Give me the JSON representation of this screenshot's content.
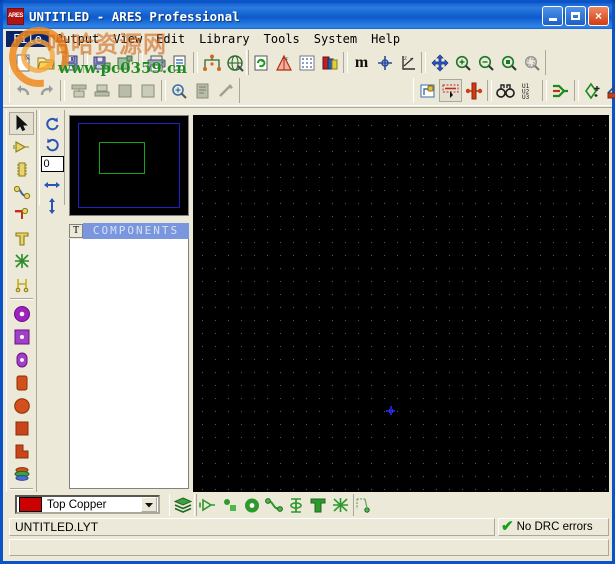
{
  "window": {
    "title": "UNTITLED - ARES Professional",
    "app_icon": "ares-icon",
    "icon_label": "ARES",
    "buttons": {
      "minimize": "minimize-button",
      "maximize": "maximize-button",
      "close": "×"
    }
  },
  "menu": [
    {
      "label": "File",
      "accel": "F",
      "selected": true
    },
    {
      "label": "Output",
      "accel": "O",
      "selected": false
    },
    {
      "label": "View",
      "accel": "V",
      "selected": false
    },
    {
      "label": "Edit",
      "accel": "E",
      "selected": false
    },
    {
      "label": "Library",
      "accel": "L",
      "selected": false
    },
    {
      "label": "Tools",
      "accel": "T",
      "selected": false
    },
    {
      "label": "System",
      "accel": "S",
      "selected": false
    },
    {
      "label": "Help",
      "accel": "H",
      "selected": false
    }
  ],
  "watermark": {
    "chinese": "哈哈资源网",
    "url": "www.pc0359.cn"
  },
  "toolbar_file": [
    {
      "icon": "new-file-icon",
      "title": "New Layout"
    },
    {
      "icon": "open-folder-icon",
      "title": "Open Layout"
    },
    {
      "icon": "save-disk-icon",
      "title": "Save Layout"
    },
    {
      "icon": "import-region-icon",
      "title": "Import Region"
    },
    {
      "icon": "export-region-icon",
      "title": "Export Region"
    },
    {
      "icon": "print-icon",
      "title": "Print Layout"
    },
    {
      "icon": "print-region-icon",
      "title": "Print Region"
    },
    {
      "icon": "netlist-icon",
      "title": "Netlist"
    },
    {
      "icon": "3d-view-icon",
      "title": "3D Visualisation"
    }
  ],
  "toolbar_view": [
    {
      "icon": "refresh-icon",
      "title": "Redraw Display"
    },
    {
      "icon": "layers-ar-icon",
      "title": "Auto Router"
    },
    {
      "icon": "grid-dots-icon",
      "title": "Toggle Grid"
    },
    {
      "icon": "layer-colors-icon",
      "title": "Layer Colours"
    },
    {
      "icon": "metric-icon",
      "title": "Toggle Metric/Imperial",
      "label": "m"
    },
    {
      "icon": "origin-icon",
      "title": "Set False Origin"
    },
    {
      "icon": "axes-icon",
      "title": "Toggle Axes"
    },
    {
      "icon": "pan-icon",
      "title": "Pan"
    },
    {
      "icon": "zoom-in-icon",
      "title": "Zoom In"
    },
    {
      "icon": "zoom-out-icon",
      "title": "Zoom Out"
    },
    {
      "icon": "zoom-all-icon",
      "title": "Zoom All"
    },
    {
      "icon": "zoom-area-icon",
      "title": "Zoom To Area"
    }
  ],
  "toolbar_edit": [
    {
      "icon": "undo-icon",
      "title": "Undo"
    },
    {
      "icon": "redo-icon",
      "title": "Redo"
    },
    {
      "icon": "cut-icon",
      "title": "Cut To Clipboard"
    },
    {
      "icon": "copy-icon",
      "title": "Copy To Clipboard"
    },
    {
      "icon": "paste-icon",
      "title": "Paste From Clipboard"
    },
    {
      "icon": "block-copy-icon",
      "title": "Block Copy"
    },
    {
      "icon": "find-icon",
      "title": "Search And Tag"
    },
    {
      "icon": "property-icon",
      "title": "Property Assignment"
    },
    {
      "icon": "tidy-icon",
      "title": "Tidy Design"
    }
  ],
  "toolbar_design": [
    {
      "icon": "board-lock-icon",
      "title": "Board Edge"
    },
    {
      "icon": "ratsnest-icon",
      "title": "Toggle Ratsnest",
      "pressed": true
    },
    {
      "icon": "ratsnest-force-icon",
      "title": "Force Vectors"
    },
    {
      "icon": "binoculars-icon",
      "title": "Find Component"
    },
    {
      "icon": "numbering-icon",
      "title": "Auto Name Generator",
      "label": "U1 U2 U3"
    },
    {
      "icon": "auto-router-icon",
      "title": "Auto Router"
    },
    {
      "icon": "drc-icon",
      "title": "Design Rule Checker"
    },
    {
      "icon": "report-icon",
      "title": "Connectivity Report"
    }
  ],
  "left_tools": [
    {
      "icon": "selection-arrow-icon",
      "title": "Selection Mode",
      "pressed": true
    },
    {
      "icon": "component-mode-icon",
      "title": "Component Mode"
    },
    {
      "icon": "package-mode-icon",
      "title": "Package Mode"
    },
    {
      "icon": "track-mode-icon",
      "title": "Track Mode"
    },
    {
      "icon": "via-mode-icon",
      "title": "Via Mode"
    },
    {
      "icon": "zone-mode-icon",
      "title": "Zone Mode"
    },
    {
      "icon": "ratsnest-mode-icon",
      "title": "Ratsnest Mode"
    },
    {
      "icon": "connectivity-mode-icon",
      "title": "Connectivity Highlight Mode"
    },
    {
      "icon": "round-pad-icon",
      "title": "Round Through-hole Pad"
    },
    {
      "icon": "square-pad-icon",
      "title": "Square Through-hole Pad"
    },
    {
      "icon": "dil-pad-icon",
      "title": "DIL Pad"
    },
    {
      "icon": "smt-pad-icon",
      "title": "SMT Pad"
    },
    {
      "icon": "circular-smt-pad-icon",
      "title": "Circular SMT Pad"
    },
    {
      "icon": "rect-smt-pad-icon",
      "title": "Rectangular SMT Pad"
    },
    {
      "icon": "polygonal-pad-icon",
      "title": "Polygonal Pad"
    },
    {
      "icon": "padstack-icon",
      "title": "Pad Stack"
    },
    {
      "icon": "2d-graphics-line-icon",
      "title": "2D Graphics Line"
    }
  ],
  "orientation": {
    "rotate_cw": "rotate-clockwise-icon",
    "rotate_ccw": "rotate-counterclockwise-icon",
    "angle_value": "0",
    "mirror_x": "mirror-horizontal-icon",
    "mirror_y": "mirror-vertical-icon"
  },
  "preview": {
    "label": "preview-pane"
  },
  "components": {
    "toggle_label": "T",
    "title": "COMPONENTS",
    "items": []
  },
  "layer_select": {
    "color": "#CC0000",
    "value": "Top Copper",
    "arrow": "▼"
  },
  "layer_toolbar": [
    {
      "icon": "layer-stack-icon",
      "title": "Layer Selector"
    },
    {
      "icon": "component-green-icon",
      "title": "Component"
    },
    {
      "icon": "package-green-icon",
      "title": "Package"
    },
    {
      "icon": "pad-green-icon",
      "title": "Pad"
    },
    {
      "icon": "track-green-icon",
      "title": "Track"
    },
    {
      "icon": "via-green-icon",
      "title": "Via"
    },
    {
      "icon": "text-green-icon",
      "title": "2D Text"
    },
    {
      "icon": "ratsnest-green-icon",
      "title": "Ratsnest"
    },
    {
      "icon": "connect-green-icon",
      "title": "Connectivity"
    }
  ],
  "status": {
    "filename": "UNTITLED.LYT",
    "drc_check": "✔",
    "drc_text": "No DRC errors",
    "message": ""
  },
  "canvas": {
    "grid_color": "#585858",
    "background": "#000000",
    "cursor_color": "#2020C8"
  }
}
